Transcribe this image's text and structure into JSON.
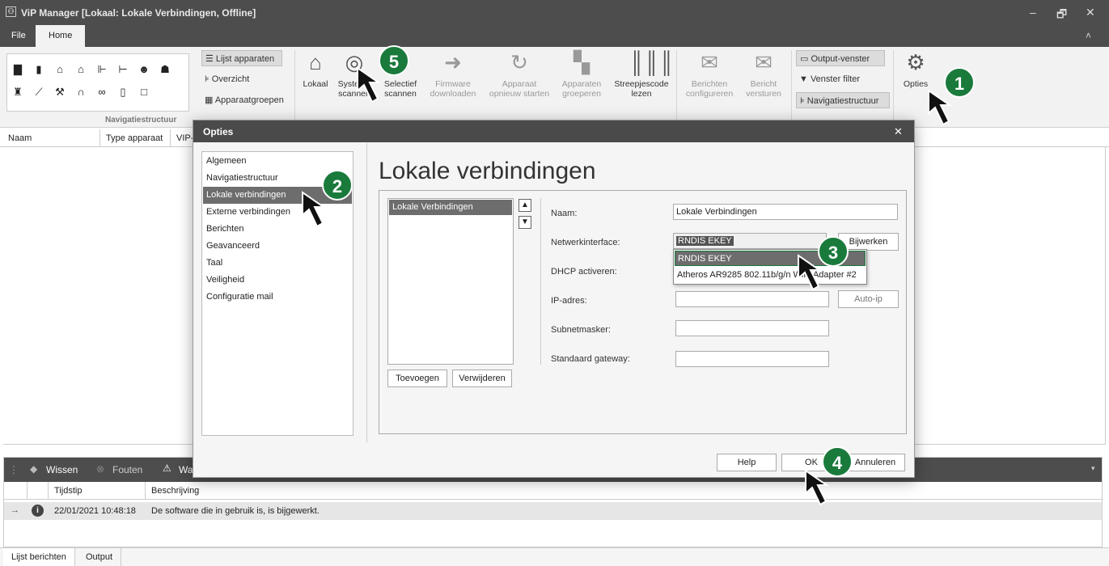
{
  "window": {
    "title": "ViP Manager [Lokaal: Lokale Verbindingen, Offline]",
    "minimize": "–",
    "restore": "🗗",
    "close": "✕",
    "collapse": "˄"
  },
  "menu": {
    "file": "File",
    "home": "Home"
  },
  "ribbon": {
    "nav_links": {
      "lijst": "Lijst apparaten",
      "overzicht": "Overzicht",
      "groepen": "Apparaatgroepen"
    },
    "group_navigatie": "Navigatiestructuur",
    "lokaal": "Lokaal",
    "systeem": "Systeem scannen",
    "selectief": "Selectief scannen",
    "firmware": "Firmware downloaden",
    "herstart": "Apparaat opnieuw starten",
    "groeperen": "Apparaten groeperen",
    "barcode": "Streepjescode lezen",
    "berichten_cfg": "Berichten configureren",
    "bericht_verst": "Bericht versturen",
    "output_venster": "Output-venster",
    "venster_filter": "Venster filter",
    "navstructuur": "Navigatiestructuur",
    "opties": "Opties"
  },
  "tree": {
    "col_naam": "Naam",
    "col_type": "Type apparaat",
    "col_vip": "VIP-"
  },
  "log": {
    "wissen": "Wissen",
    "fouten": "Fouten",
    "wa": "Wa",
    "col_tijd": "Tijdstip",
    "col_beschr": "Beschrijving",
    "rows": [
      {
        "time": "22/01/2021 10:48:18",
        "desc": "De software die in gebruik is, is bijgewerkt."
      }
    ]
  },
  "bottom_tabs": {
    "lijst": "Lijst berichten",
    "output": "Output"
  },
  "dialog": {
    "title": "Opties",
    "heading": "Lokale verbindingen",
    "nav": [
      "Algemeen",
      "Navigatiestructuur",
      "Lokale verbindingen",
      "Externe verbindingen",
      "Berichten",
      "Geavanceerd",
      "Taal",
      "Veiligheid",
      "Configuratie mail"
    ],
    "conn_list": [
      "Lokale Verbindingen"
    ],
    "add": "Toevoegen",
    "remove": "Verwijderen",
    "labels": {
      "naam": "Naam:",
      "netwerk": "Netwerkinterface:",
      "dhcp": "DHCP activeren:",
      "ip": "IP-adres:",
      "subnet": "Subnetmasker:",
      "gateway": "Standaard gateway:"
    },
    "values": {
      "naam": "Lokale Verbindingen",
      "netwerk": "RNDIS EKEY"
    },
    "dropdown": [
      "RNDIS EKEY",
      "Atheros AR9285 802.11b/g/n WiFi Adapter #2"
    ],
    "bijwerken": "Bijwerken",
    "autoip": "Auto-ip",
    "help": "Help",
    "ok": "OK",
    "annuleren": "Annuleren"
  },
  "badges": [
    "1",
    "2",
    "3",
    "4",
    "5"
  ],
  "colors": {
    "accent": "#1a7a3c",
    "titlebar": "#4d4d4d",
    "selected": "#6d6d6d"
  }
}
